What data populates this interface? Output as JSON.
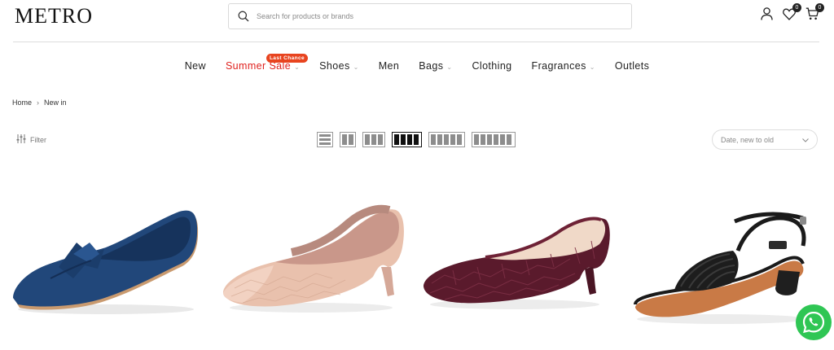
{
  "header": {
    "logo": "METRO",
    "search_placeholder": "Search for products or brands",
    "wishlist_count": "0",
    "cart_count": "0"
  },
  "nav": {
    "items": [
      {
        "label": "New",
        "has_dropdown": false
      },
      {
        "label": "Summer Sale",
        "has_dropdown": true,
        "badge": "Last Chance"
      },
      {
        "label": "Shoes",
        "has_dropdown": true
      },
      {
        "label": "Men",
        "has_dropdown": false
      },
      {
        "label": "Bags",
        "has_dropdown": true
      },
      {
        "label": "Clothing",
        "has_dropdown": false
      },
      {
        "label": "Fragrances",
        "has_dropdown": true
      },
      {
        "label": "Outlets",
        "has_dropdown": false
      }
    ]
  },
  "breadcrumb": {
    "home": "Home",
    "current": "New in"
  },
  "toolbar": {
    "filter_label": "Filter",
    "sort_selected": "Date, new to old"
  },
  "colors": {
    "sale_red": "#e0221f",
    "badge_orange": "#e8441f",
    "whatsapp_green": "#2fc654"
  }
}
